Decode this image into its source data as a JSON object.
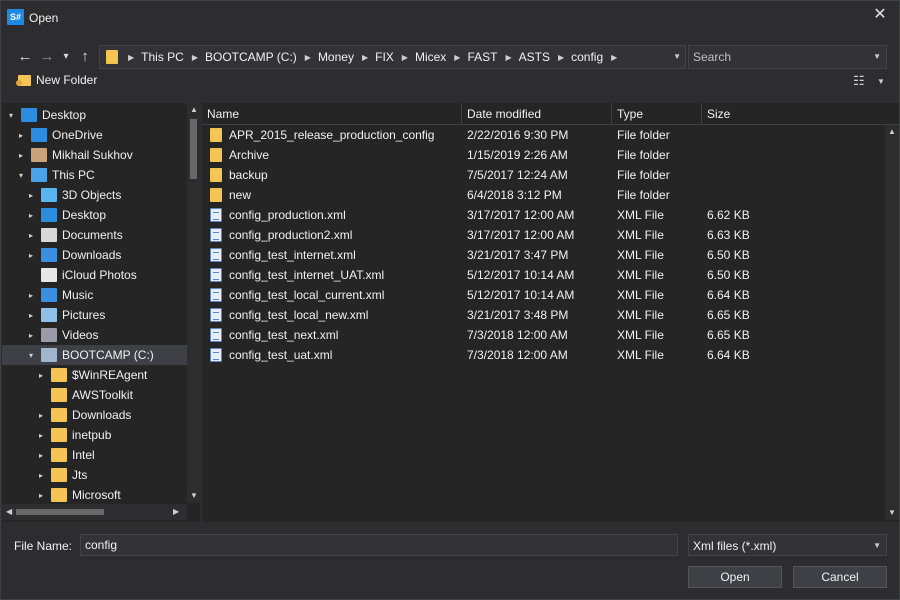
{
  "window": {
    "icon_text": "S#",
    "title": "Open",
    "close_glyph": "✕"
  },
  "nav": {
    "back_glyph": "←",
    "forward_glyph": "→",
    "recent_glyph": "▾",
    "up_glyph": "↑"
  },
  "address": {
    "crumbs": [
      "This PC",
      "BOOTCAMP (C:)",
      "Money",
      "FIX",
      "Micex",
      "FAST",
      "ASTS",
      "config"
    ]
  },
  "search": {
    "placeholder": "Search"
  },
  "toolbar": {
    "new_folder_label": "New Folder",
    "views_glyph": "☷"
  },
  "tree": {
    "items": [
      {
        "label": "Desktop",
        "level": 0,
        "expander": "▾",
        "icon": "desktop-icon",
        "color": "#2b8ce0",
        "selected": false
      },
      {
        "label": "OneDrive",
        "level": 1,
        "expander": "▸",
        "icon": "cloud-icon",
        "color": "#2b8ce0",
        "selected": false
      },
      {
        "label": "Mikhail Sukhov",
        "level": 1,
        "expander": "▸",
        "icon": "user-icon",
        "color": "#c9a37a",
        "selected": false
      },
      {
        "label": "This PC",
        "level": 1,
        "expander": "▾",
        "icon": "computer-icon",
        "color": "#4aa3e8",
        "selected": false
      },
      {
        "label": "3D Objects",
        "level": 2,
        "expander": "▸",
        "icon": "cube-icon",
        "color": "#5ab4f0",
        "selected": false
      },
      {
        "label": "Desktop",
        "level": 2,
        "expander": "▸",
        "icon": "desktop-icon",
        "color": "#2b8ce0",
        "selected": false
      },
      {
        "label": "Documents",
        "level": 2,
        "expander": "▸",
        "icon": "document-icon",
        "color": "#d8d8d8",
        "selected": false
      },
      {
        "label": "Downloads",
        "level": 2,
        "expander": "▸",
        "icon": "download-icon",
        "color": "#3a8fe0",
        "selected": false
      },
      {
        "label": "iCloud Photos",
        "level": 2,
        "expander": "",
        "icon": "photos-icon",
        "color": "#e8e8e8",
        "selected": false
      },
      {
        "label": "Music",
        "level": 2,
        "expander": "▸",
        "icon": "music-icon",
        "color": "#3a8fe0",
        "selected": false
      },
      {
        "label": "Pictures",
        "level": 2,
        "expander": "▸",
        "icon": "picture-icon",
        "color": "#8fc0ea",
        "selected": false
      },
      {
        "label": "Videos",
        "level": 2,
        "expander": "▸",
        "icon": "video-icon",
        "color": "#9a9aa8",
        "selected": false
      },
      {
        "label": "BOOTCAMP (C:)",
        "level": 2,
        "expander": "▾",
        "icon": "drive-icon",
        "color": "#9fb6cc",
        "selected": true
      },
      {
        "label": "$WinREAgent",
        "level": 3,
        "expander": "▸",
        "icon": "folder-icon",
        "color": "#f4c553",
        "selected": false
      },
      {
        "label": "AWSToolkit",
        "level": 3,
        "expander": "",
        "icon": "folder-icon",
        "color": "#f4c553",
        "selected": false
      },
      {
        "label": "Downloads",
        "level": 3,
        "expander": "▸",
        "icon": "folder-icon",
        "color": "#f4c553",
        "selected": false
      },
      {
        "label": "inetpub",
        "level": 3,
        "expander": "▸",
        "icon": "folder-icon",
        "color": "#f4c553",
        "selected": false
      },
      {
        "label": "Intel",
        "level": 3,
        "expander": "▸",
        "icon": "folder-icon",
        "color": "#f4c553",
        "selected": false
      },
      {
        "label": "Jts",
        "level": 3,
        "expander": "▸",
        "icon": "folder-icon",
        "color": "#f4c553",
        "selected": false
      },
      {
        "label": "Microsoft",
        "level": 3,
        "expander": "▸",
        "icon": "folder-icon",
        "color": "#f4c553",
        "selected": false
      }
    ]
  },
  "list": {
    "columns": [
      "Name",
      "Date modified",
      "Type",
      "Size"
    ],
    "rows": [
      {
        "name": "APR_2015_release_production_config",
        "date": "2/22/2016 9:30 PM",
        "type": "File folder",
        "size": "",
        "kind": "folder"
      },
      {
        "name": "Archive",
        "date": "1/15/2019 2:26 AM",
        "type": "File folder",
        "size": "",
        "kind": "folder"
      },
      {
        "name": "backup",
        "date": "7/5/2017 12:24 AM",
        "type": "File folder",
        "size": "",
        "kind": "folder"
      },
      {
        "name": "new",
        "date": "6/4/2018 3:12 PM",
        "type": "File folder",
        "size": "",
        "kind": "folder"
      },
      {
        "name": "config_production.xml",
        "date": "3/17/2017 12:00 AM",
        "type": "XML File",
        "size": "6.62 KB",
        "kind": "xml"
      },
      {
        "name": "config_production2.xml",
        "date": "3/17/2017 12:00 AM",
        "type": "XML File",
        "size": "6.63 KB",
        "kind": "xml"
      },
      {
        "name": "config_test_internet.xml",
        "date": "3/21/2017 3:47 PM",
        "type": "XML File",
        "size": "6.50 KB",
        "kind": "xml"
      },
      {
        "name": "config_test_internet_UAT.xml",
        "date": "5/12/2017 10:14 AM",
        "type": "XML File",
        "size": "6.50 KB",
        "kind": "xml"
      },
      {
        "name": "config_test_local_current.xml",
        "date": "5/12/2017 10:14 AM",
        "type": "XML File",
        "size": "6.64 KB",
        "kind": "xml"
      },
      {
        "name": "config_test_local_new.xml",
        "date": "3/21/2017 3:48 PM",
        "type": "XML File",
        "size": "6.65 KB",
        "kind": "xml"
      },
      {
        "name": "config_test_next.xml",
        "date": "7/3/2018 12:00 AM",
        "type": "XML File",
        "size": "6.65 KB",
        "kind": "xml"
      },
      {
        "name": "config_test_uat.xml",
        "date": "7/3/2018 12:00 AM",
        "type": "XML File",
        "size": "6.64 KB",
        "kind": "xml"
      }
    ]
  },
  "footer": {
    "file_name_label": "File Name:",
    "file_name_value": "config",
    "filter_label": "Xml files (*.xml)",
    "open_label": "Open",
    "cancel_label": "Cancel"
  },
  "colors": {
    "background": "#2d2d30",
    "panel": "#252526",
    "folder": "#f4c553",
    "selection": "#3f3f46",
    "text": "#f1f1f1"
  }
}
